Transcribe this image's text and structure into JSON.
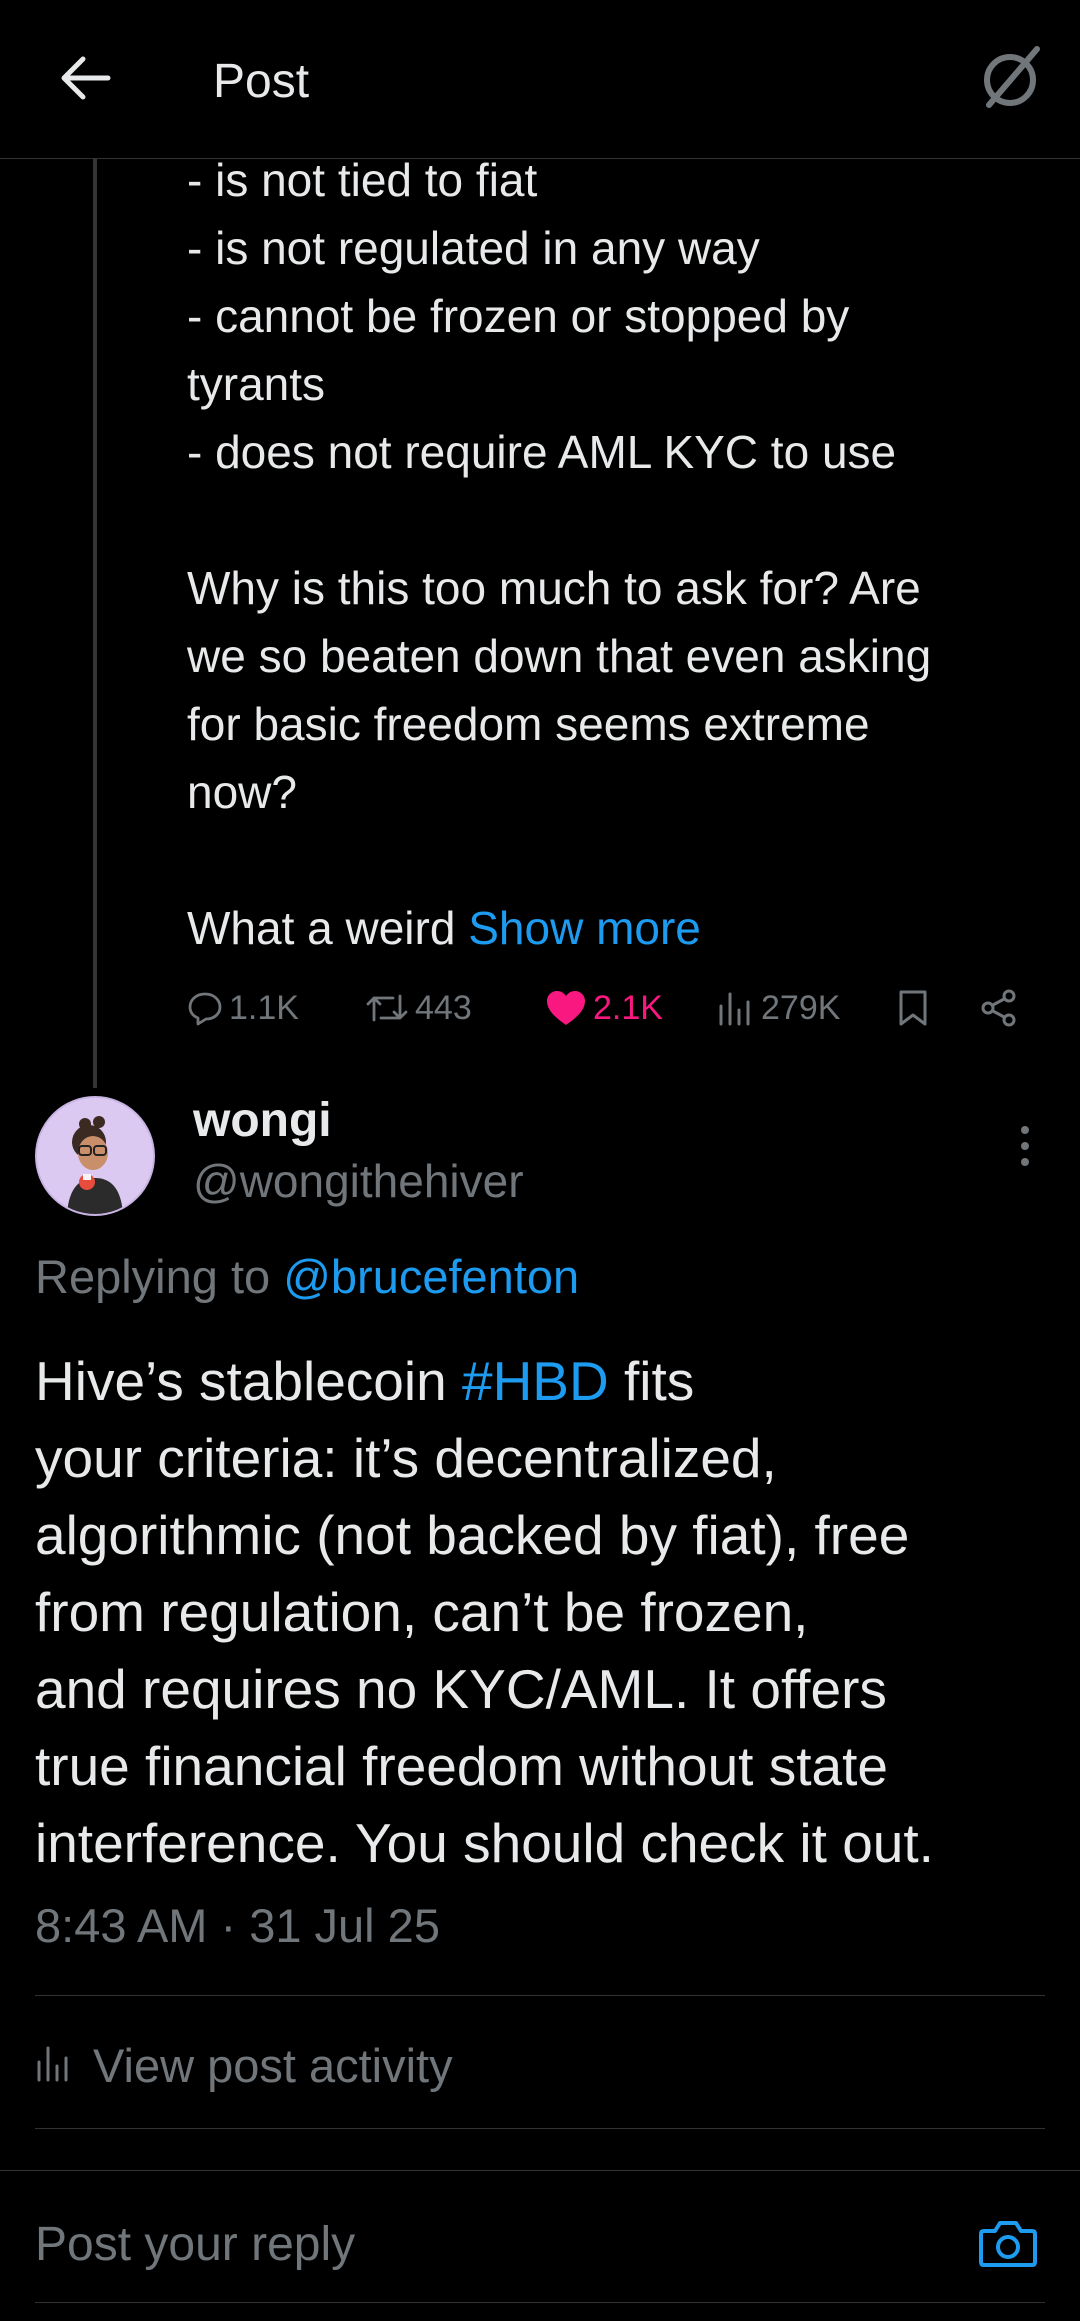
{
  "header": {
    "title": "Post",
    "back_icon": "arrow-left-icon",
    "grok_icon": "grok-icon"
  },
  "parent_post": {
    "lines": [
      "- is not tied to fiat",
      "- is not regulated in any way",
      "- cannot be frozen or stopped by",
      "tyrants",
      "- does not require AML KYC to use",
      "",
      "Why is this too much to ask for?  Are",
      "we so beaten down that even asking",
      "for basic freedom seems extreme",
      "now?",
      ""
    ],
    "truncated_text": "What a weird ",
    "show_more": "Show more",
    "stats": {
      "replies": "1.1K",
      "reposts": "443",
      "likes": "2.1K",
      "views": "279K"
    }
  },
  "reply_post": {
    "display_name": "wongi",
    "handle": "@wongithehiver",
    "replying_prefix": "Replying to ",
    "replying_to": "@brucefenton",
    "text_line1_before": "Hive’s stablecoin ",
    "hashtag": "#HBD",
    "text_line1_after": " fits",
    "lines": [
      "your criteria: it’s decentralized,",
      "algorithmic (not backed by fiat), free",
      "from regulation, can’t be frozen,",
      "and requires no KYC/AML. It offers",
      "true financial freedom without state",
      "interference. You should check it out."
    ],
    "timestamp": "8:43 AM · 31 Jul 25",
    "view_activity": "View post activity"
  },
  "composer": {
    "placeholder": "Post your reply",
    "camera_icon": "camera-icon"
  },
  "colors": {
    "background": "#000000",
    "text": "#e7e9ea",
    "muted": "#71767b",
    "link": "#1d9bf0",
    "like": "#f91880",
    "divider": "#2f3336"
  }
}
